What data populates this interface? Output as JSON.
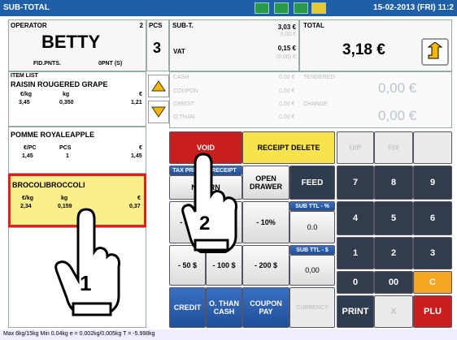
{
  "topbar": {
    "title": "SUB-TOTAL",
    "date": "15-02-2013 (FRI) 11:2"
  },
  "operator": {
    "label": "OPERATOR",
    "num": "2",
    "name": "BETTY",
    "fid": "FID.PNTS.",
    "opnt": "0PNT (S)"
  },
  "pcs": {
    "label": "PCS",
    "value": "3"
  },
  "subt": {
    "label": "SUB-T.",
    "value": "3,03 €",
    "minus": "- 0,00 €",
    "vat_label": "VAT",
    "vat": "0,15 €",
    "vat2": "(0,00) €"
  },
  "total": {
    "label": "TOTAL",
    "value": "3,18 €"
  },
  "items": {
    "header": "ITEM LIST",
    "i1": {
      "name": "RAISIN ROUGERED GRAPE",
      "h1": "€/kg",
      "h2": "kg",
      "h3": "€",
      "v1": "3,45",
      "v2": "0,350",
      "v3": "1,21"
    },
    "i2": {
      "name": "POMME ROYALEAPPLE",
      "h1": "€/PC",
      "h2": "PCS",
      "h3": "€",
      "v1": "1,45",
      "v2": "1",
      "v3": "1,45"
    },
    "i3": {
      "name": "BROCOLIBROCCOLI",
      "h1": "€/kg",
      "h2": "kg",
      "h3": "€",
      "v1": "2,34",
      "v2": "0,159",
      "v3": "0,37"
    }
  },
  "pay": {
    "cash": "CASH",
    "coupon": "COUPON",
    "credit": "CREDIT",
    "othan": "O.THAN",
    "amt": "0,00 €",
    "tendered": "TENDERED",
    "change": "CHANGE",
    "tval": "0,00 €",
    "cval": "0,00 €"
  },
  "buttons": {
    "void": "VOID",
    "receipt_delete": "RECEIPT DELETE",
    "up": "U/P",
    "fix": "FIX",
    "tax_print": "TAX PRINT",
    "receipt": "RECEIPT",
    "no_prn": "NO-PRN",
    "open_drawer": "OPEN DRAWER",
    "feed": "FEED",
    "sub_pct": "SUB TTL - %",
    "sub_amt": "SUB TTL - $",
    "zero1": "0.0",
    "zero2": "0,00",
    "p5": "- 5%",
    "p10": "- 10%",
    "m50": "- 50 $",
    "m100": "- 100 $",
    "m200": "- 200 $",
    "credit": "CREDIT",
    "othan_cash": "O. THAN CASH",
    "coupon_pay": "COUPON PAY",
    "currency": "CURRENCY",
    "print": "PRINT",
    "x": "X",
    "plu": "PLU",
    "c": "C",
    "n00": "00",
    "n0": "0",
    "n1": "1",
    "n2": "2",
    "n3": "3",
    "n4": "4",
    "n5": "5",
    "n6": "6",
    "n7": "7",
    "n8": "8",
    "n9": "9"
  },
  "footer": "Max 6kg/15kg  Min 0.04kg  e = 0.002kg/0.005kg  T = -5.998kg",
  "callouts": {
    "one": "1",
    "two": "2"
  }
}
